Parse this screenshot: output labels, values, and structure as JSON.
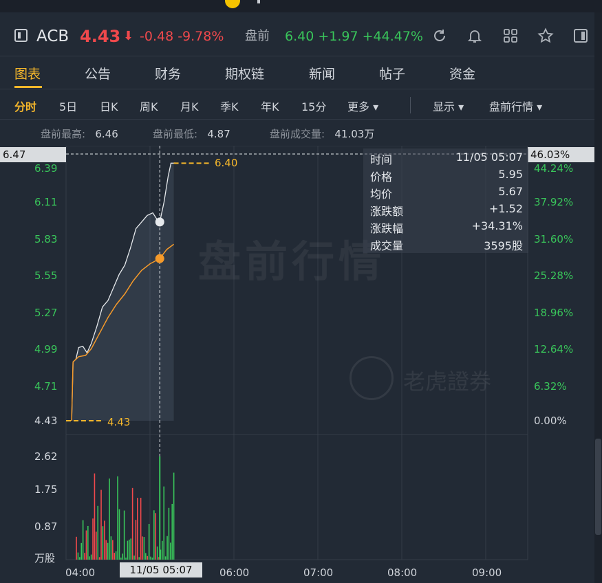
{
  "header": {
    "ticker": "ACB",
    "price": "4.43",
    "arrow": "⬇",
    "change": "-0.48 -9.78%",
    "premarket_label": "盘前",
    "premarket_values": "6.40 +1.97 +44.47%"
  },
  "icons": [
    "sidebar-toggle-icon",
    "refresh-icon",
    "bell-icon",
    "grid-icon",
    "star-icon",
    "panel-icon"
  ],
  "tabs": [
    "图表",
    "公告",
    "财务",
    "期权链",
    "新闻",
    "帖子",
    "资金"
  ],
  "periods": [
    "分时",
    "5日",
    "日K",
    "周K",
    "月K",
    "季K",
    "年K",
    "15分",
    "更多 ▾"
  ],
  "display_menu": "显示 ▾",
  "premarket_menu": "盘前行情 ▾",
  "stats": {
    "high_label": "盘前最高:",
    "high": "6.46",
    "low_label": "盘前最低:",
    "low": "4.87",
    "vol_label": "盘前成交量:",
    "vol": "41.03万"
  },
  "crosshair": {
    "price": "6.47",
    "pct": "46.03%",
    "time": "11/05 05:07"
  },
  "tooltip": {
    "rows": [
      {
        "k": "时间",
        "v": "11/05 05:07"
      },
      {
        "k": "价格",
        "v": "5.95"
      },
      {
        "k": "均价",
        "v": "5.67"
      },
      {
        "k": "涨跌额",
        "v": "+1.52"
      },
      {
        "k": "涨跌幅",
        "v": "+34.31%"
      },
      {
        "k": "成交量",
        "v": "3595股"
      }
    ]
  },
  "watermark": "盘前行情",
  "brand": "老虎證券",
  "last_label": "6.40",
  "base_label": "4.43",
  "colors": {
    "up": "#39c55a",
    "down": "#f0494c",
    "accent": "#f5b72b",
    "avg": "#f59a2a"
  },
  "chart_data": {
    "type": "line",
    "y_ticks": [
      "6.39",
      "6.11",
      "5.83",
      "5.55",
      "5.27",
      "4.99",
      "4.71",
      "4.43"
    ],
    "pct_ticks": [
      "44.24%",
      "37.92%",
      "31.60%",
      "25.28%",
      "18.96%",
      "12.64%",
      "6.32%",
      "0.00%"
    ],
    "vol_ticks": [
      "2.62",
      "1.75",
      "0.87",
      "万股"
    ],
    "x_ticks": [
      "04:00",
      "06:00",
      "07:00",
      "08:00",
      "09:00"
    ],
    "x_range": [
      "04:00",
      "09:30"
    ],
    "ylim": [
      4.43,
      6.47
    ],
    "price_series": [
      [
        "04:04",
        4.43
      ],
      [
        "04:05",
        4.88
      ],
      [
        "04:07",
        4.9
      ],
      [
        "04:09",
        4.99
      ],
      [
        "04:12",
        5.0
      ],
      [
        "04:15",
        4.95
      ],
      [
        "04:18",
        5.02
      ],
      [
        "04:22",
        5.15
      ],
      [
        "04:26",
        5.3
      ],
      [
        "04:30",
        5.35
      ],
      [
        "04:34",
        5.45
      ],
      [
        "04:38",
        5.55
      ],
      [
        "04:42",
        5.62
      ],
      [
        "04:46",
        5.75
      ],
      [
        "04:50",
        5.9
      ],
      [
        "04:54",
        5.95
      ],
      [
        "04:58",
        6.0
      ],
      [
        "05:02",
        6.02
      ],
      [
        "05:05",
        5.97
      ],
      [
        "05:07",
        5.95
      ],
      [
        "05:10",
        6.1
      ],
      [
        "05:13",
        6.3
      ],
      [
        "05:15",
        6.4
      ],
      [
        "05:17",
        6.4
      ]
    ],
    "avg_series": [
      [
        "04:04",
        4.43
      ],
      [
        "04:05",
        4.88
      ],
      [
        "04:09",
        4.92
      ],
      [
        "04:14",
        4.93
      ],
      [
        "04:18",
        4.98
      ],
      [
        "04:24",
        5.1
      ],
      [
        "04:30",
        5.22
      ],
      [
        "04:36",
        5.32
      ],
      [
        "04:42",
        5.4
      ],
      [
        "04:48",
        5.5
      ],
      [
        "04:54",
        5.58
      ],
      [
        "05:00",
        5.63
      ],
      [
        "05:07",
        5.67
      ],
      [
        "05:12",
        5.74
      ],
      [
        "05:17",
        5.78
      ]
    ],
    "volume_max": 3.0
  }
}
